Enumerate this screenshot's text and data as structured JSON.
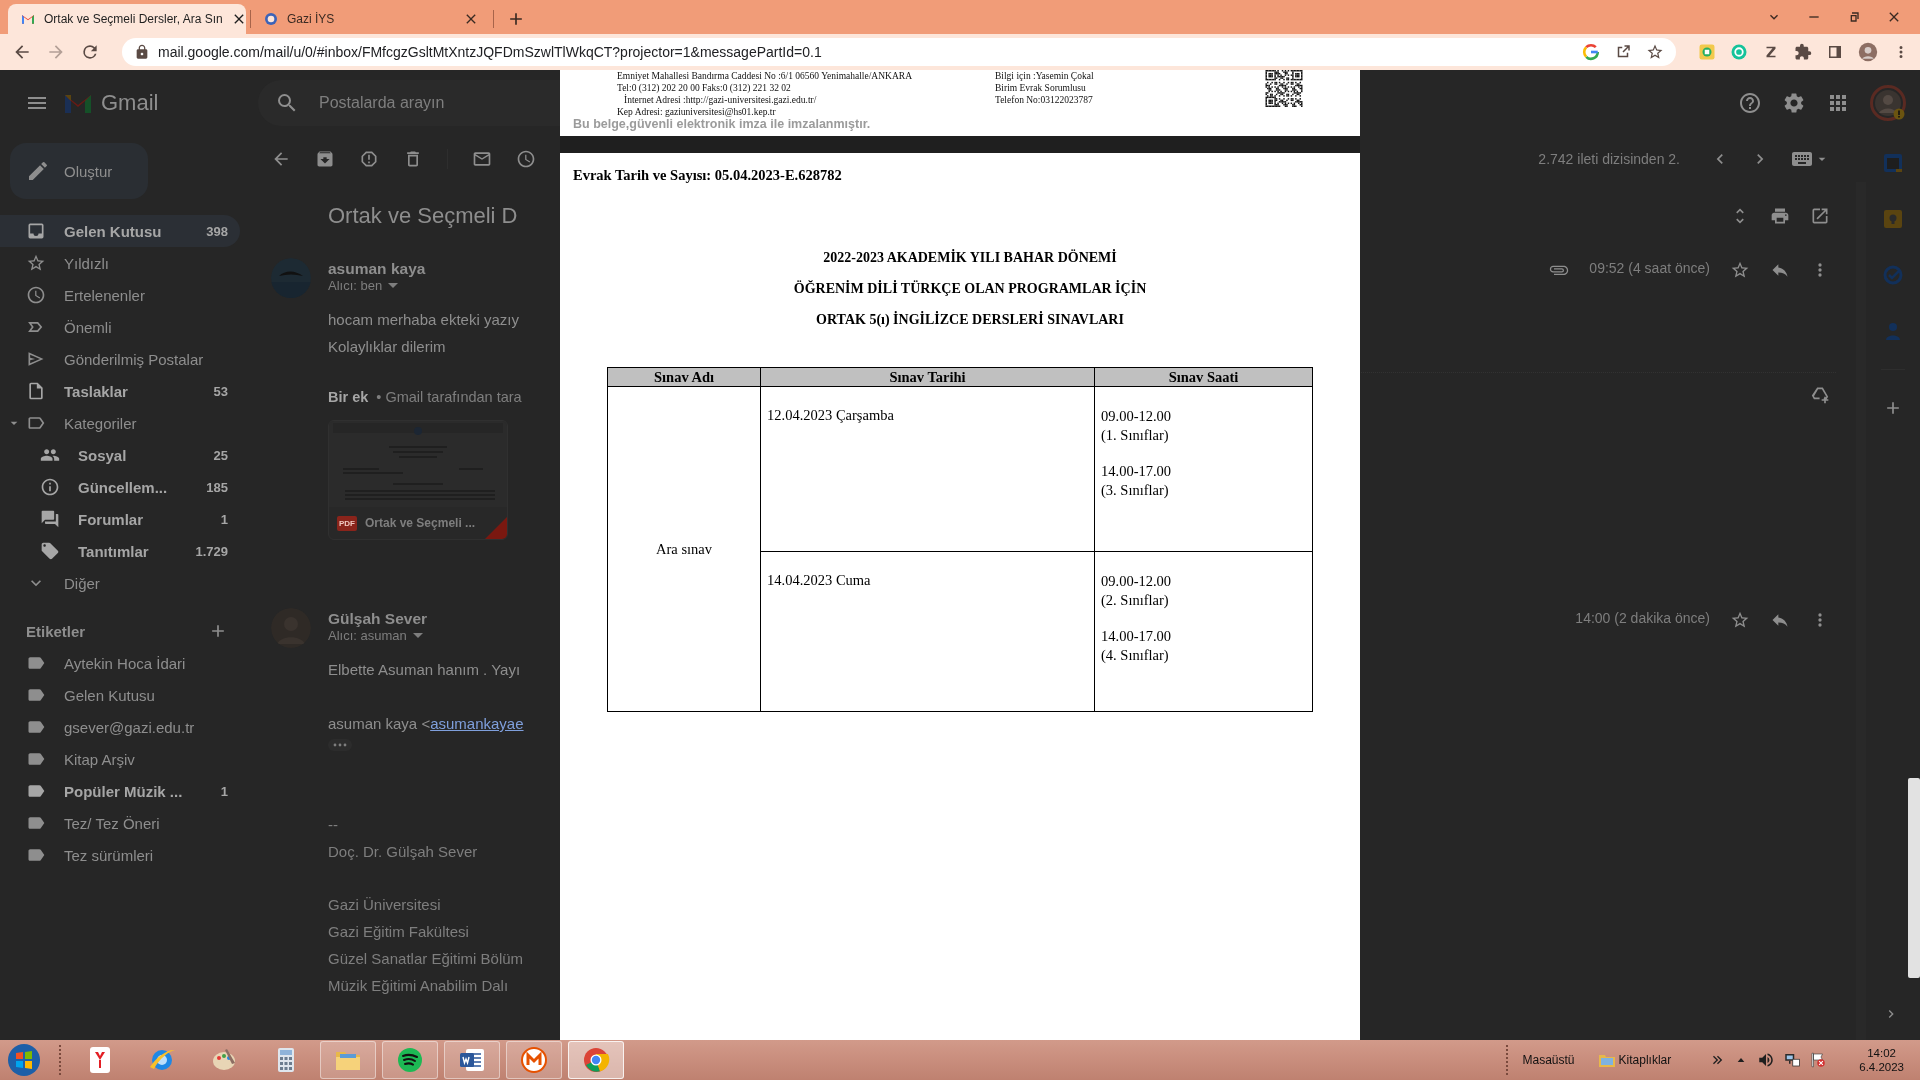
{
  "browser": {
    "tabs": [
      {
        "title": "Ortak ve Seçmeli Dersler, Ara Sın",
        "selected": true
      },
      {
        "title": "Gazi İYS",
        "selected": false
      }
    ],
    "url": "mail.google.com/mail/u/0/#inbox/FMfcgzGsltMtXntzJQFDmSzwlTlWkqCT?projector=1&messagePartId=0.1"
  },
  "gmail": {
    "app_name": "Gmail",
    "search": {
      "placeholder": "Postalarda arayın"
    },
    "compose": "Oluştur",
    "nav": [
      {
        "label": "Gelen Kutusu",
        "count": "398",
        "selected": true,
        "unread": true
      },
      {
        "label": "Yıldızlı",
        "selected": false,
        "unread": false
      },
      {
        "label": "Ertelenenler",
        "selected": false,
        "unread": false
      },
      {
        "label": "Önemli",
        "selected": false,
        "unread": false
      },
      {
        "label": "Gönderilmiş Postalar",
        "selected": false,
        "unread": false
      },
      {
        "label": "Taslaklar",
        "count": "53",
        "selected": false,
        "unread": true
      },
      {
        "label": "Kategoriler",
        "selected": false,
        "unread": false,
        "expanded": true,
        "children": [
          {
            "label": "Sosyal",
            "count": "25",
            "selected": false,
            "unread": true
          },
          {
            "label": "Güncellem...",
            "count": "185",
            "selected": false,
            "unread": true
          },
          {
            "label": "Forumlar",
            "count": "1",
            "selected": false,
            "unread": true
          },
          {
            "label": "Tanıtımlar",
            "count": "1.729",
            "selected": false,
            "unread": true
          }
        ]
      },
      {
        "label": "Diğer",
        "selected": false,
        "unread": false
      }
    ],
    "labels": {
      "title": "Etiketler",
      "items": [
        {
          "label": "Aytekin Hoca İdari",
          "unread": false
        },
        {
          "label": "Gelen Kutusu",
          "unread": false
        },
        {
          "label": "gsever@gazi.edu.tr",
          "unread": false
        },
        {
          "label": "Kitap Arşiv",
          "unread": false
        },
        {
          "label": "Popüler Müzik ...",
          "count": "1",
          "unread": true
        },
        {
          "label": "Tez/ Tez Öneri",
          "unread": false
        },
        {
          "label": "Tez sürümleri",
          "unread": false
        }
      ]
    },
    "position": "2.742 ileti dizisinden 2.",
    "thread": {
      "subject": "Ortak ve Seçmeli D",
      "messages": [
        {
          "sender": "asuman kaya",
          "recipient": "Alıcı: ben",
          "time": "09:52 (4 saat önce)",
          "has_attachment": true,
          "starred": false,
          "body": [
            "hocam  merhaba ekteki yazıy",
            "Kolaylıklar dilerim"
          ],
          "attachment": {
            "summary": "**Bir ek** • Gmail tarafından tara",
            "badge": "PDF",
            "file_name": "Ortak ve Seçmeli ..."
          }
        },
        {
          "sender": "Gülşah Sever",
          "recipient": "Alıcı: asuman",
          "time": "14:00 (2 dakika önce)",
          "has_attachment": false,
          "starred": false,
          "body": [
            "Elbette Asuman hanım . Yayı"
          ],
          "quote": {
            "prefix": "asuman kaya <",
            "link": "asumankayae"
          },
          "signature": [
            [
              "--",
              "Doç. Dr. Gülşah Sever"
            ],
            [
              "Gazi Üniversitesi",
              "Gazi Eğitim Fakültesi",
              "Güzel Sanatlar Eğitimi Bölüm",
              "Müzik Eğitimi Anabilim Dalı"
            ]
          ]
        }
      ]
    }
  },
  "document": {
    "page_header": {
      "address_lines": [
        "Emniyet Mahallesi Bandırma Caddesi No :6/1 06560 Yenimahalle/ANKARA",
        "Tel:0 (312) 202 20 00   Faks:0 (312) 221 32 02",
        "İnternet Adresi :http://gazi-universitesi.gazi.edu.tr/",
        "Kep Adresi: gaziuniversitesi@hs01.kep.tr"
      ],
      "contact_lines": [
        "Bilgi için :Yasemin Çokal",
        "Birim Evrak Sorumlusu",
        "Telefon No:03122023787"
      ],
      "signature_note": "Bu belge,güvenli elektronik imza ile imzalanmıştır."
    },
    "page": {
      "reference": "Evrak Tarih ve Sayısı: 05.04.2023-E.628782",
      "title_lines": [
        "2022-2023 AKADEMİK YILI BAHAR DÖNEMİ",
        "ÖĞRENİM DİLİ TÜRKÇE OLAN PROGRAMLAR İÇİN",
        "ORTAK 5(ı) İNGİLİZCE DERSLERİ SINAVLARI"
      ],
      "table": {
        "columns": [
          "Sınav Adı",
          "Sınav Tarihi",
          "Sınav Saati"
        ],
        "rows": [
          {
            "exam": "Ara sınav",
            "sessions": [
              {
                "date": "12.04.2023 Çarşamba",
                "slots": [
                  {
                    "time": "09.00-12.00",
                    "group": "(1. Sınıflar)"
                  },
                  {
                    "time": "14.00-17.00",
                    "group": "(3. Sınıflar)"
                  }
                ]
              },
              {
                "date": "14.04.2023 Cuma",
                "slots": [
                  {
                    "time": "09.00-12.00",
                    "group": "(2. Sınıflar)"
                  },
                  {
                    "time": "14.00-17.00",
                    "group": "(4. Sınıflar)"
                  }
                ]
              }
            ]
          }
        ]
      }
    }
  },
  "taskbar": {
    "apps": [
      {
        "running": false,
        "selected": false
      },
      {
        "running": false,
        "selected": false
      },
      {
        "running": false,
        "selected": false
      },
      {
        "running": false,
        "selected": false
      },
      {
        "running": true,
        "selected": false
      },
      {
        "running": true,
        "selected": false
      },
      {
        "running": true,
        "selected": false
      },
      {
        "running": true,
        "selected": false
      },
      {
        "running": true,
        "selected": true
      }
    ],
    "toolbars": [
      "Masaüstü",
      "Kitaplıklar"
    ],
    "clock": {
      "time": "14:02",
      "date": "6.4.2023"
    }
  }
}
